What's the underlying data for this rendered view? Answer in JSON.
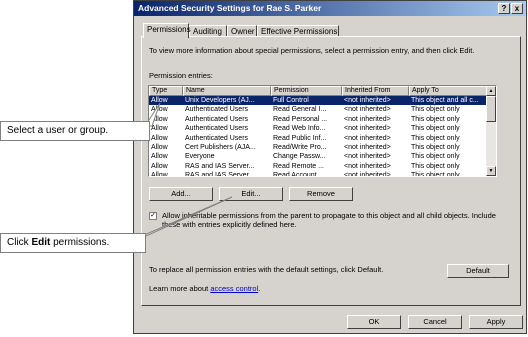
{
  "window": {
    "title": "Advanced Security Settings for Rae S. Parker",
    "help_label": "?",
    "close_label": "x"
  },
  "tabs": [
    {
      "label": "Permissions"
    },
    {
      "label": "Auditing"
    },
    {
      "label": "Owner"
    },
    {
      "label": "Effective Permissions"
    }
  ],
  "main": {
    "info_text": "To view more information about special permissions, select a permission entry, and then click Edit.",
    "entries_label": "Permission entries:",
    "columns": [
      "Type",
      "Name",
      "Permission",
      "Inherited From",
      "Apply To"
    ],
    "rows": [
      [
        "Allow",
        "Unix Developers (AJ...",
        "Full Control",
        "<not inherited>",
        "This object and all c..."
      ],
      [
        "Allow",
        "Authenticated Users",
        "Read General I...",
        "<not inherited>",
        "This object only"
      ],
      [
        "Allow",
        "Authenticated Users",
        "Read Personal ...",
        "<not inherited>",
        "This object only"
      ],
      [
        "Allow",
        "Authenticated Users",
        "Read Web Info...",
        "<not inherited>",
        "This object only"
      ],
      [
        "Allow",
        "Authenticated Users",
        "Read Public Inf...",
        "<not inherited>",
        "This object only"
      ],
      [
        "Allow",
        "Cert Publishers (AJA...",
        "Read/Write Pro...",
        "<not inherited>",
        "This object only"
      ],
      [
        "Allow",
        "Everyone",
        "Change Passw...",
        "<not inherited>",
        "This object only"
      ],
      [
        "Allow",
        "RAS and IAS Server...",
        "Read Remote ...",
        "<not inherited>",
        "This object only"
      ],
      [
        "Allow",
        "RAS and IAS Server...",
        "Read Account ...",
        "<not inherited>",
        "This object only"
      ]
    ],
    "add_label": "Add...",
    "edit_label": "Edit...",
    "remove_label": "Remove",
    "inherit_checked": true,
    "inherit_line1": "Allow inheritable permissions from the parent to propagate to this object and all child objects. Include",
    "inherit_line2": "these with entries explicitly defined here.",
    "default_text": "To replace all permission entries with the default settings, click Default.",
    "default_label": "Default",
    "learn_prefix": "Learn more about",
    "learn_link": "access control",
    "learn_suffix": "."
  },
  "footer": {
    "ok_label": "OK",
    "cancel_label": "Cancel",
    "apply_label": "Apply"
  },
  "callouts": {
    "select_text": "Select a user or group.",
    "click_prefix": "Click",
    "click_bold": "Edit",
    "click_suffix": "permissions."
  },
  "colors": {
    "titlebar": "#0a246a",
    "selection": "#0a246a",
    "dialog_face": "#d6d3ce",
    "link": "#0000cc"
  },
  "icons": {
    "checkbox_mark": "✓",
    "scroll_up": "▲",
    "scroll_down": "▼"
  }
}
